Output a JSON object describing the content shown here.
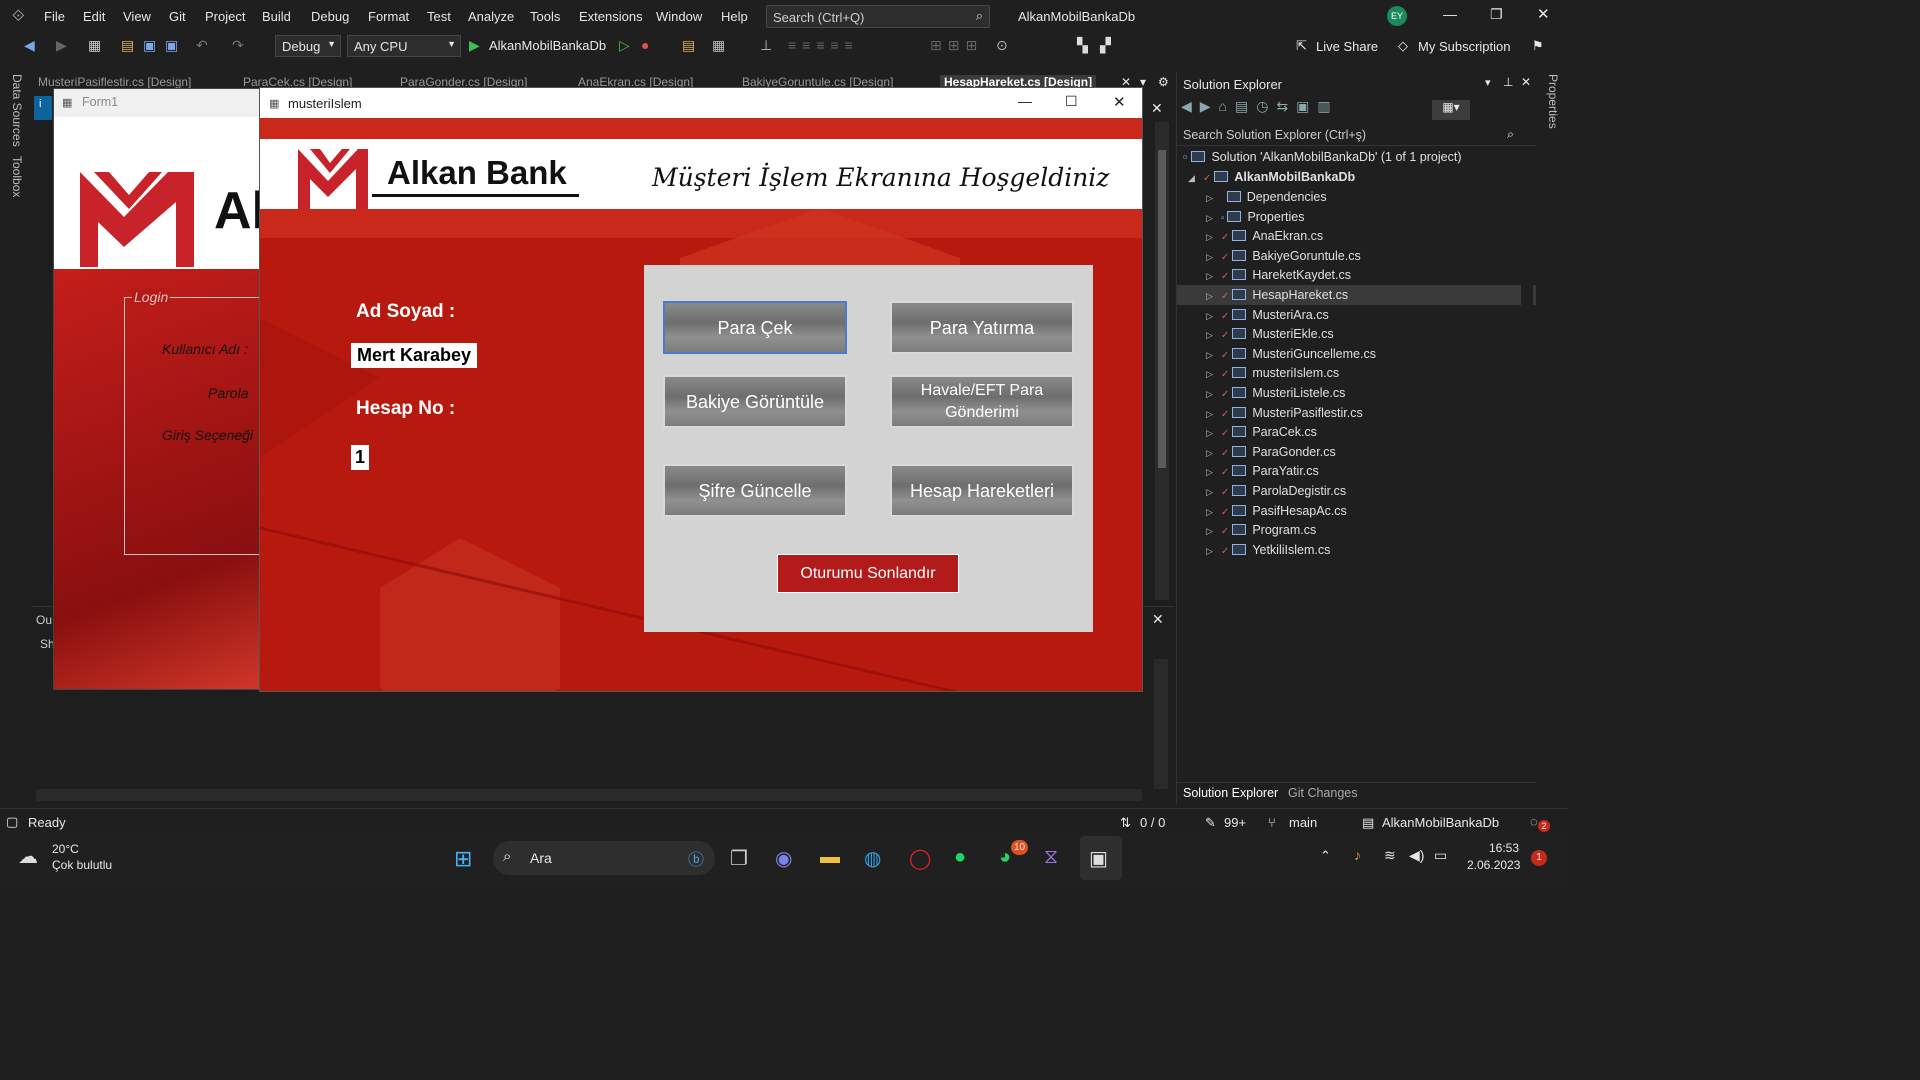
{
  "titlebar": {
    "menus": [
      "File",
      "Edit",
      "View",
      "Git",
      "Project",
      "Build",
      "Debug",
      "Format",
      "Test",
      "Analyze",
      "Tools",
      "Extensions",
      "Window",
      "Help"
    ],
    "search_placeholder": "Search (Ctrl+Q)",
    "solution_name": "AlkanMobilBankaDb",
    "avatar": "EY"
  },
  "toolbar": {
    "config": "Debug",
    "platform": "Any CPU",
    "run_target": "AlkanMobilBankaDb",
    "live_share": "Live Share",
    "subscription": "My Subscription"
  },
  "tabs": [
    "MusteriPasiflestir.cs [Design]",
    "ParaCek.cs [Design]",
    "ParaGonder.cs [Design]",
    "AnaEkran.cs [Design]",
    "BakiyeGoruntule.cs [Design]",
    "HesapHareket.cs [Design]"
  ],
  "left_strip": [
    "Data Sources",
    "Toolbox"
  ],
  "right_strip": "Properties",
  "form1": {
    "title": "Form1",
    "logo_text": "Al",
    "group": "Login",
    "fields": [
      "Kullanıcı Adı :",
      "Parola",
      "Giriş Seçeneği"
    ]
  },
  "window": {
    "title": "musteriIslem",
    "bank_name": "Alkan Bank",
    "welcome": "Müşteri İşlem Ekranına Hoşgeldiniz",
    "name_label": "Ad Soyad :",
    "name_value": "Mert Karabey",
    "account_label": "Hesap No :",
    "account_value": "1",
    "buttons": [
      "Para Çek",
      "Para Yatırma",
      "Bakiye Görüntüle",
      "Havale/EFT Para Gönderimi",
      "Şifre Güncelle",
      "Hesap Hareketleri"
    ],
    "logout": "Oturumu Sonlandır"
  },
  "output": {
    "tab": "Ou",
    "show": "Sh"
  },
  "solution_explorer": {
    "title": "Solution Explorer",
    "search_placeholder": "Search Solution Explorer (Ctrl+ş)",
    "solution": "Solution 'AlkanMobilBankaDb' (1 of 1 project)",
    "project": "AlkanMobilBankaDb",
    "items": [
      "Dependencies",
      "Properties",
      "AnaEkran.cs",
      "BakiyeGoruntule.cs",
      "HareketKaydet.cs",
      "HesapHareket.cs",
      "MusteriAra.cs",
      "MusteriEkle.cs",
      "MusteriGuncelleme.cs",
      "musteriIslem.cs",
      "MusteriListele.cs",
      "MusteriPasiflestir.cs",
      "ParaCek.cs",
      "ParaGonder.cs",
      "ParaYatir.cs",
      "ParolaDegistir.cs",
      "PasifHesapAc.cs",
      "Program.cs",
      "YetkiliIslem.cs"
    ],
    "selected": "HesapHareket.cs",
    "bottom_tabs": [
      "Solution Explorer",
      "Git Changes"
    ]
  },
  "statusbar": {
    "status": "Ready",
    "lines": "0 / 0",
    "changes": "99+",
    "branch": "main",
    "repo": "AlkanMobilBankaDb",
    "notifications": "2"
  },
  "taskbar": {
    "weather_temp": "20°C",
    "weather_desc": "Çok bulutlu",
    "search": "Ara",
    "whatsapp_badge": "10",
    "time": "16:53",
    "date": "2.06.2023",
    "notif": "1"
  }
}
